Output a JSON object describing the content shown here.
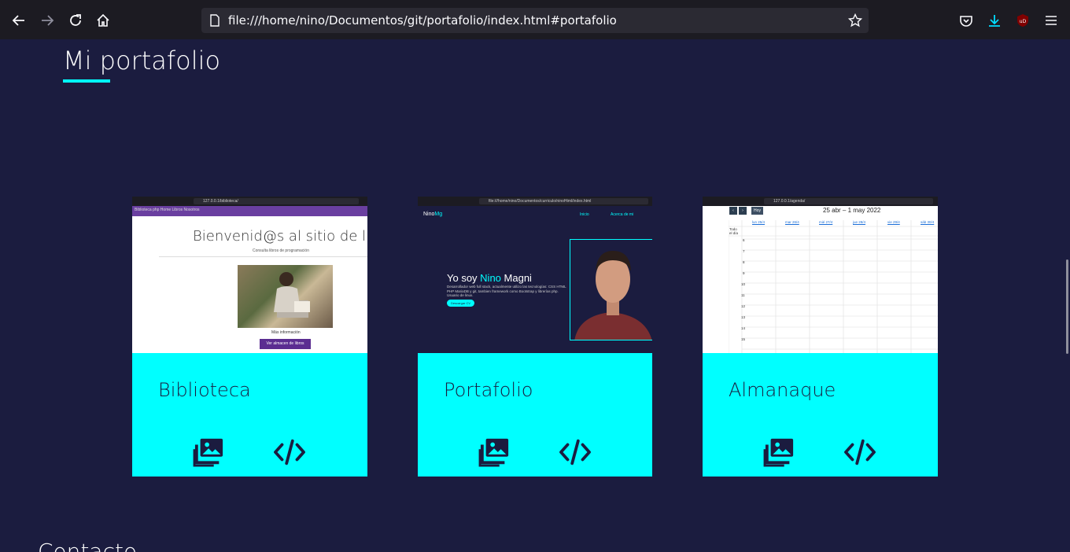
{
  "browser": {
    "url": "file:///home/nino/Documentos/git/portafolio/index.html#portafolio",
    "icons": [
      "back-icon",
      "forward-icon",
      "reload-icon",
      "home-icon",
      "page-icon",
      "bookmark-star-icon",
      "pocket-icon",
      "download-icon",
      "ublock-icon",
      "menu-icon"
    ]
  },
  "section": {
    "title": "Mi portafolio",
    "accent": "#00ffff",
    "background": "#1b1c3f"
  },
  "next_section": {
    "title": "Contacto"
  },
  "cards": [
    {
      "name": "Biblioteca",
      "shot": {
        "url": "127.0.0.1/biblioteca/",
        "nav": "Biblioteca php   Home   Libros   Nosotros",
        "title": "Bienvenid@s al sitio de libros",
        "subtitle": "Consulta libros de programación",
        "more": "Más información",
        "button": "Ver almacen de libros"
      },
      "icons": [
        "gallery-icon",
        "code-icon"
      ]
    },
    {
      "name": "Portafolio",
      "shot": {
        "url": "file:///home/nino/Documentos/curriculo/ninoHtml/index.html",
        "logo_a": "Nino",
        "logo_b": "Mg",
        "nav_1": "Inicio",
        "nav_2": "Acerca de mi",
        "hello_a": "Yo soy ",
        "hello_b": "Nino",
        "hello_c": " Magni",
        "desc": "Desarrollador web full stack, actualmente utilizo las tecnologías: CSS HTML PHP MariaDB y git, tambien framework como Bootstrap y librerías php. Usuario de linux.",
        "cv": "Descargar CV"
      },
      "icons": [
        "gallery-icon",
        "code-icon"
      ]
    },
    {
      "name": "Almanaque",
      "shot": {
        "url": "127.0.0.1/agenda/",
        "today": "Hoy",
        "range": "25 abr – 1 may 2022",
        "days": [
          "lun 25/4",
          "mar 26/4",
          "mié 27/4",
          "jue 28/4",
          "vie 29/4",
          "sáb 30/4"
        ],
        "allday": "Todo el día",
        "hours": [
          "6",
          "7",
          "8",
          "9",
          "10",
          "11",
          "12",
          "13",
          "14",
          "15"
        ]
      },
      "icons": [
        "gallery-icon",
        "code-icon"
      ]
    }
  ]
}
